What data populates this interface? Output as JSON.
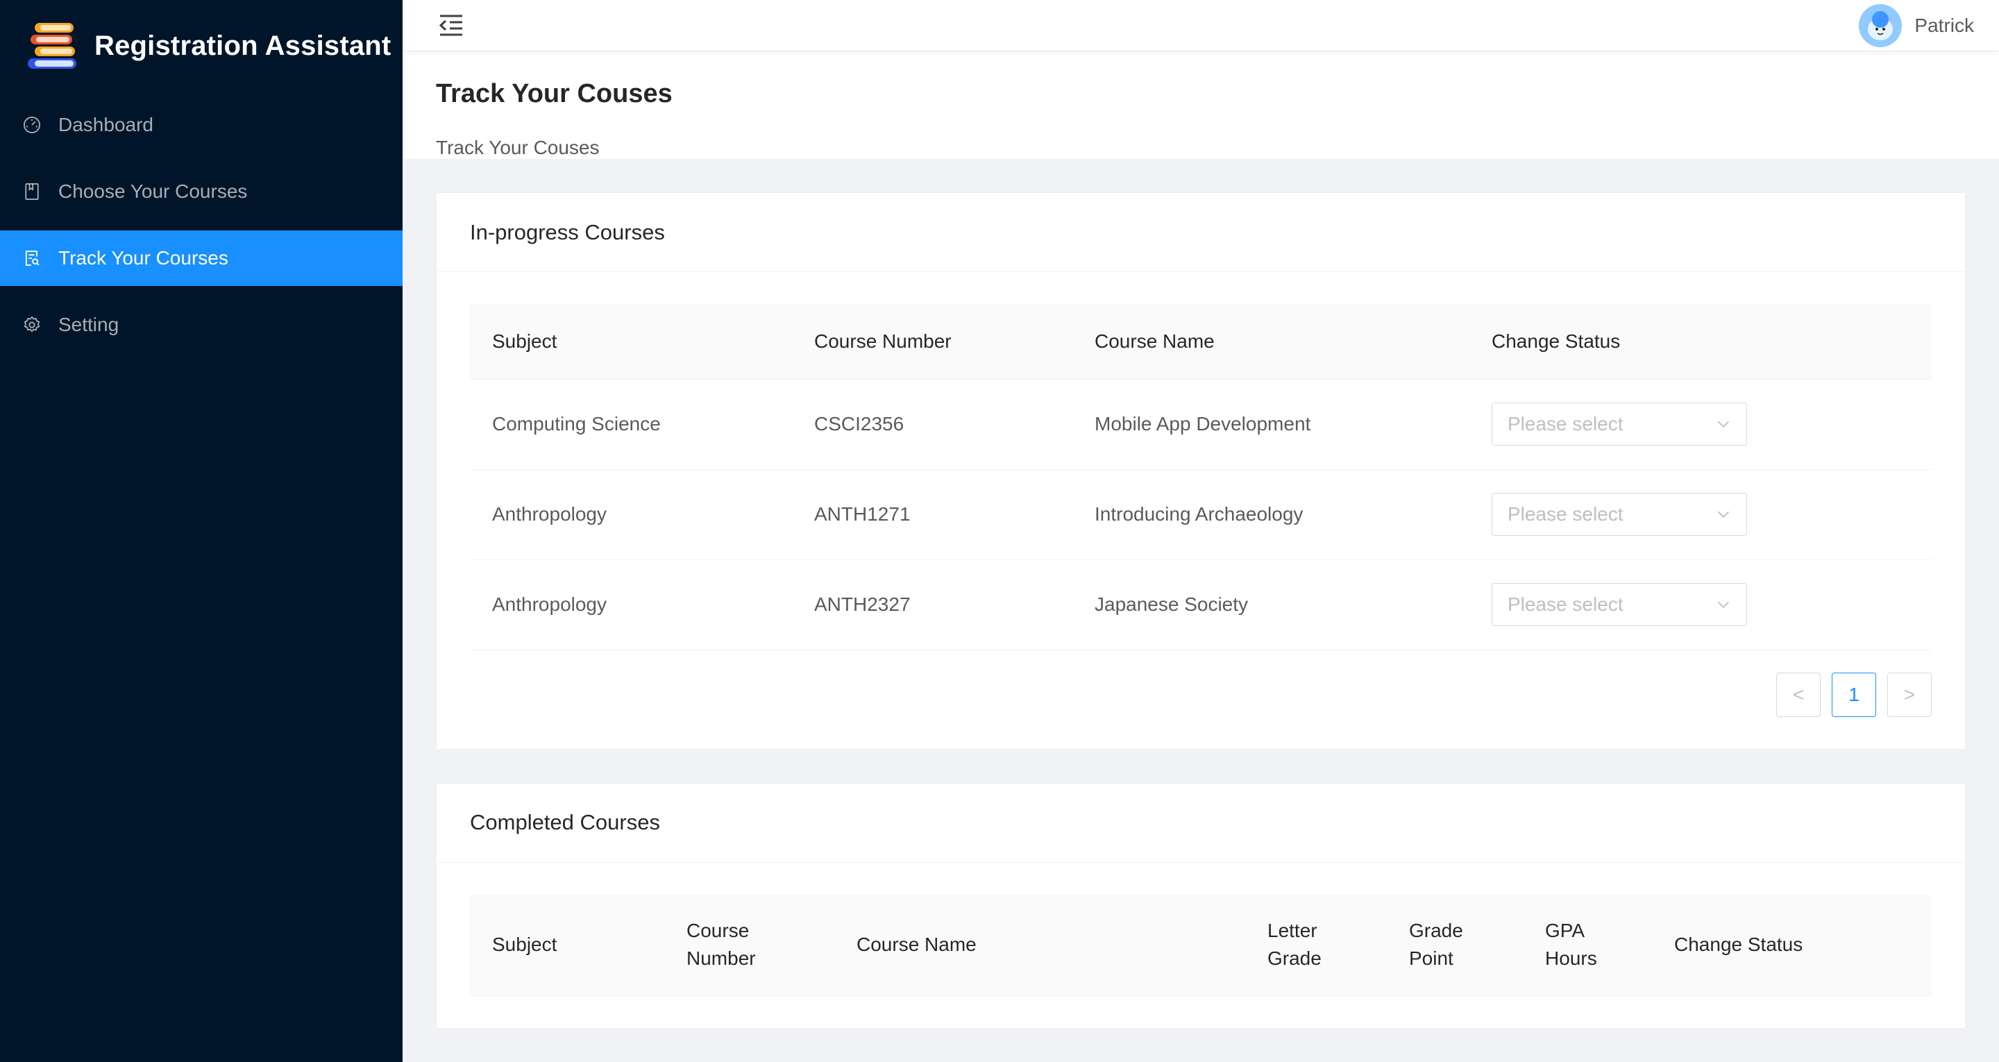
{
  "app": {
    "title": "Registration Assistant"
  },
  "sidebar": {
    "items": [
      {
        "label": "Dashboard",
        "icon": "dashboard-icon",
        "active": false
      },
      {
        "label": "Choose Your Courses",
        "icon": "book-icon",
        "active": false
      },
      {
        "label": "Track Your Courses",
        "icon": "file-search-icon",
        "active": true
      },
      {
        "label": "Setting",
        "icon": "gear-icon",
        "active": false
      }
    ]
  },
  "header": {
    "username": "Patrick"
  },
  "page": {
    "title": "Track Your Couses",
    "subtitle": "Track Your Couses"
  },
  "inprogress": {
    "title": "In-progress Courses",
    "columns": [
      "Subject",
      "Course Number",
      "Course Name",
      "Change Status"
    ],
    "rows": [
      {
        "subject": "Computing Science",
        "number": "CSCI2356",
        "name": "Mobile App Development",
        "status_placeholder": "Please select"
      },
      {
        "subject": "Anthropology",
        "number": "ANTH1271",
        "name": "Introducing Archaeology",
        "status_placeholder": "Please select"
      },
      {
        "subject": "Anthropology",
        "number": "ANTH2327",
        "name": "Japanese Society",
        "status_placeholder": "Please select"
      }
    ],
    "pagination": {
      "current": "1",
      "prev": "<",
      "next": ">"
    }
  },
  "completed": {
    "title": "Completed Courses",
    "columns": [
      "Subject",
      "Course Number",
      "Course Name",
      "Letter Grade",
      "Grade Point",
      "GPA Hours",
      "Change Status"
    ]
  },
  "colors": {
    "sidebar_bg": "#001529",
    "accent": "#1890ff"
  }
}
